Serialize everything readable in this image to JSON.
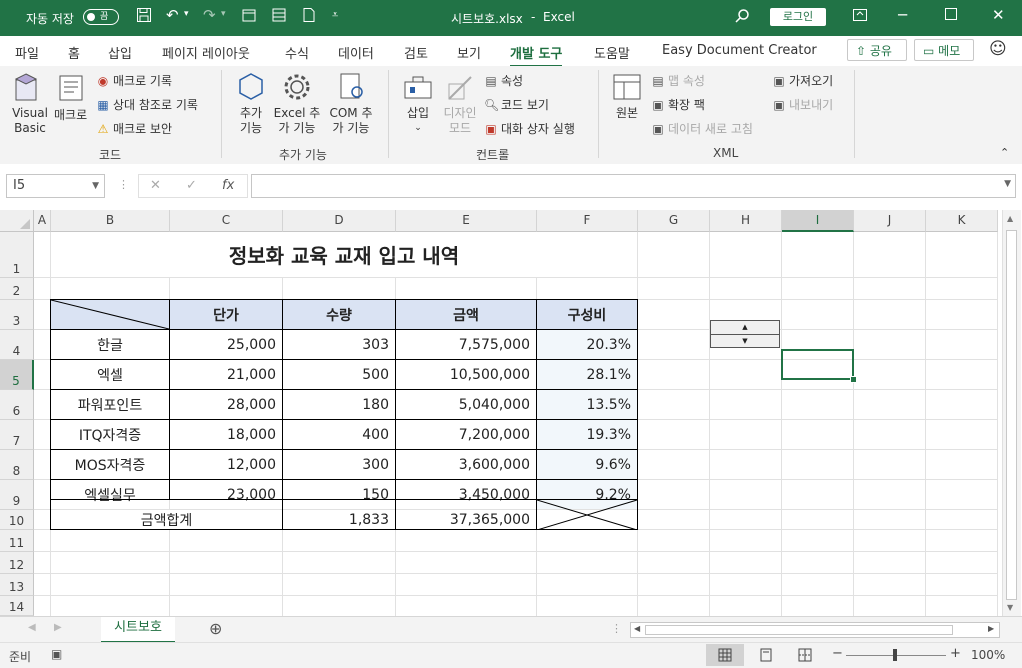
{
  "titlebar": {
    "autosave_label": "자동 저장",
    "autosave_state": "끔",
    "file_name": "시트보호.xlsx",
    "separator": "-",
    "app_name": "Excel",
    "signin_label": "로그인",
    "accent_color": "#217346"
  },
  "tabs": {
    "items": [
      "파일",
      "홈",
      "삽입",
      "페이지 레이아웃",
      "수식",
      "데이터",
      "검토",
      "보기",
      "개발 도구",
      "도움말",
      "Easy Document Creator"
    ],
    "active": "개발 도구",
    "share_label": "공유",
    "memo_label": "메모"
  },
  "ribbon": {
    "code": {
      "label": "코드",
      "visual_basic": "Visual Basic",
      "macro": "매크로",
      "record_macro": "매크로 기록",
      "relative_ref": "상대 참조로 기록",
      "macro_security": "매크로 보안"
    },
    "addins": {
      "label": "추가 기능",
      "addins": "추가 기능",
      "excel_addins": "Excel 추가 기능",
      "com_addins": "COM 추가 기능"
    },
    "controls": {
      "label": "컨트롤",
      "insert": "삽입",
      "design_mode": "디자인 모드",
      "properties": "속성",
      "view_code": "코드 보기",
      "run_dialog": "대화 상자 실행"
    },
    "xml": {
      "label": "XML",
      "source": "원본",
      "map_properties": "맵 속성",
      "expansion_packs": "확장 팩",
      "refresh_data": "데이터 새로 고침",
      "import": "가져오기",
      "export": "내보내기"
    }
  },
  "formula_bar": {
    "name_box": "I5",
    "formula": ""
  },
  "grid": {
    "columns": [
      "A",
      "B",
      "C",
      "D",
      "E",
      "F",
      "G",
      "H",
      "I",
      "J",
      "K"
    ],
    "selected_column": "I",
    "rows": [
      "1",
      "2",
      "3",
      "4",
      "5",
      "6",
      "7",
      "8",
      "9",
      "10",
      "11",
      "12",
      "13",
      "14"
    ],
    "selected_row": "5"
  },
  "sheet": {
    "title": "정보화 교육 교재 입고 내역",
    "headers": [
      "단가",
      "수량",
      "금액",
      "구성비"
    ],
    "rows": [
      {
        "name": "한글",
        "price": "25,000",
        "qty": "303",
        "amount": "7,575,000",
        "ratio": "20.3%"
      },
      {
        "name": "엑셀",
        "price": "21,000",
        "qty": "500",
        "amount": "10,500,000",
        "ratio": "28.1%"
      },
      {
        "name": "파워포인트",
        "price": "28,000",
        "qty": "180",
        "amount": "5,040,000",
        "ratio": "13.5%"
      },
      {
        "name": "ITQ자격증",
        "price": "18,000",
        "qty": "400",
        "amount": "7,200,000",
        "ratio": "19.3%"
      },
      {
        "name": "MOS자격증",
        "price": "12,000",
        "qty": "300",
        "amount": "3,600,000",
        "ratio": "9.6%"
      },
      {
        "name": "엑셀실무",
        "price": "23,000",
        "qty": "150",
        "amount": "3,450,000",
        "ratio": "9.2%"
      }
    ],
    "total": {
      "label": "금액합계",
      "qty": "1,833",
      "amount": "37,365,000"
    },
    "header_fill": "#dae3f3",
    "ratio_fill": "#f2f7fb"
  },
  "sheet_tabs": {
    "active": "시트보호"
  },
  "status": {
    "ready": "준비",
    "zoom": "100%"
  }
}
